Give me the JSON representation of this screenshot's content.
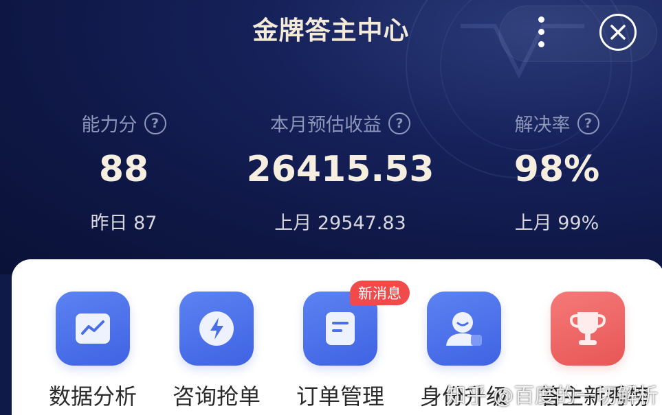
{
  "header": {
    "title": "金牌答主中心"
  },
  "stats": [
    {
      "label": "能力分",
      "value": "88",
      "prev": "昨日 87"
    },
    {
      "label": "本月预估收益",
      "value": "26415.53",
      "prev": "上月 29547.83"
    },
    {
      "label": "解决率",
      "value": "98%",
      "prev": "上月 99%"
    }
  ],
  "tools": [
    {
      "label": "数据分析",
      "icon": "chart-icon"
    },
    {
      "label": "咨询抢单",
      "icon": "lightning-icon"
    },
    {
      "label": "订单管理",
      "icon": "document-icon"
    },
    {
      "label": "身份升级",
      "icon": "person-icon"
    },
    {
      "label": "答主新秀榜",
      "icon": "trophy-icon"
    }
  ],
  "badge": {
    "text": "新消息"
  },
  "watermark": {
    "text": "知乎 @百度的一切解析"
  },
  "colors": {
    "hero_bg": "#0e1744",
    "gold_text": "#f6eedf",
    "tool_blue": "#4a6ee8",
    "tool_red": "#ec6362",
    "badge_red": "#f04a4a"
  }
}
